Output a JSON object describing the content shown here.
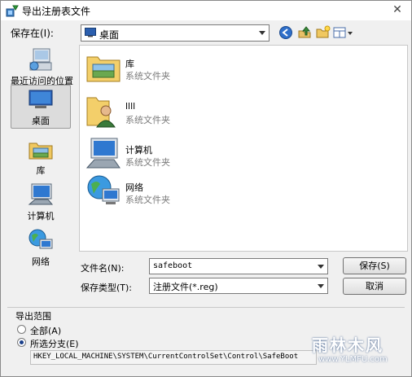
{
  "window": {
    "title": "导出注册表文件",
    "close": "✕"
  },
  "save_in": {
    "label": "保存在(I):",
    "value": "桌面"
  },
  "places": [
    {
      "label": "最近访问的位置",
      "icon": "recent-places-icon"
    },
    {
      "label": "桌面",
      "icon": "desktop-icon",
      "selected": true
    },
    {
      "label": "库",
      "icon": "libraries-icon"
    },
    {
      "label": "计算机",
      "icon": "computer-icon"
    },
    {
      "label": "网络",
      "icon": "network-icon"
    }
  ],
  "files": [
    {
      "name": "库",
      "type": "系统文件夹",
      "icon": "libraries-folder-icon"
    },
    {
      "name": "llll",
      "type": "系统文件夹",
      "icon": "user-folder-icon"
    },
    {
      "name": "计算机",
      "type": "系统文件夹",
      "icon": "computer-icon"
    },
    {
      "name": "网络",
      "type": "系统文件夹",
      "icon": "network-icon"
    }
  ],
  "filename": {
    "label": "文件名(N):",
    "value": "safeboot"
  },
  "filetype": {
    "label": "保存类型(T):",
    "value": "注册文件(*.reg)"
  },
  "buttons": {
    "save": "保存(S)",
    "cancel": "取消"
  },
  "export_range": {
    "title": "导出范围",
    "all": "全部(A)",
    "selected_branch": "所选分支(E)",
    "selected": "selected_branch",
    "branch_path": "HKEY_LOCAL_MACHINE\\SYSTEM\\CurrentControlSet\\Control\\SafeBoot"
  },
  "watermark": {
    "title": "雨林木风",
    "url": "www.YLMFU.com"
  }
}
